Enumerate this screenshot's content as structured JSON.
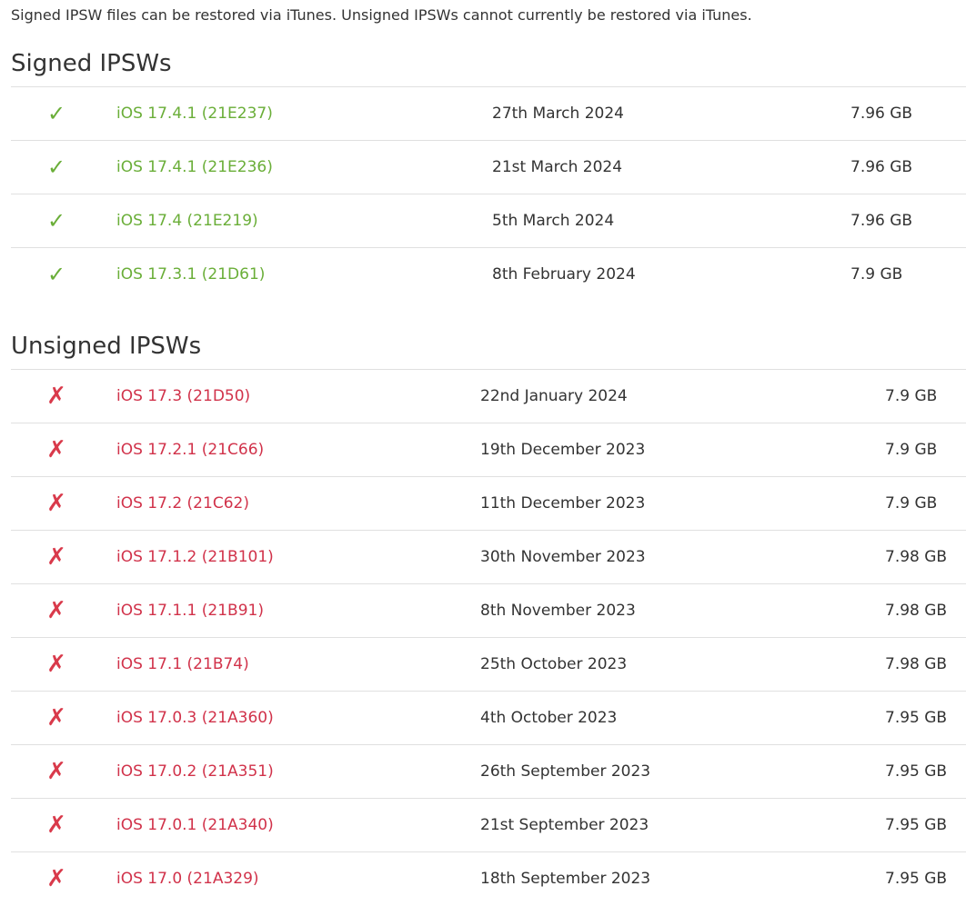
{
  "intro": "Signed IPSW files can be restored via iTunes. Unsigned IPSWs cannot currently be restored via iTunes.",
  "signed": {
    "heading": "Signed IPSWs",
    "icon": "✓",
    "rows": [
      {
        "version": "iOS 17.4.1 (21E237)",
        "date": "27th March 2024",
        "size": "7.96 GB"
      },
      {
        "version": "iOS 17.4.1 (21E236)",
        "date": "21st March 2024",
        "size": "7.96 GB"
      },
      {
        "version": "iOS 17.4 (21E219)",
        "date": "5th March 2024",
        "size": "7.96 GB"
      },
      {
        "version": "iOS 17.3.1 (21D61)",
        "date": "8th February 2024",
        "size": "7.9 GB"
      }
    ]
  },
  "unsigned": {
    "heading": "Unsigned IPSWs",
    "icon": "✗",
    "rows": [
      {
        "version": "iOS 17.3 (21D50)",
        "date": "22nd January 2024",
        "size": "7.9 GB"
      },
      {
        "version": "iOS 17.2.1 (21C66)",
        "date": "19th December 2023",
        "size": "7.9 GB"
      },
      {
        "version": "iOS 17.2 (21C62)",
        "date": "11th December 2023",
        "size": "7.9 GB"
      },
      {
        "version": "iOS 17.1.2 (21B101)",
        "date": "30th November 2023",
        "size": "7.98 GB"
      },
      {
        "version": "iOS 17.1.1 (21B91)",
        "date": "8th November 2023",
        "size": "7.98 GB"
      },
      {
        "version": "iOS 17.1 (21B74)",
        "date": "25th October 2023",
        "size": "7.98 GB"
      },
      {
        "version": "iOS 17.0.3 (21A360)",
        "date": "4th October 2023",
        "size": "7.95 GB"
      },
      {
        "version": "iOS 17.0.2 (21A351)",
        "date": "26th September 2023",
        "size": "7.95 GB"
      },
      {
        "version": "iOS 17.0.1 (21A340)",
        "date": "21st September 2023",
        "size": "7.95 GB"
      },
      {
        "version": "iOS 17.0 (21A329)",
        "date": "18th September 2023",
        "size": "7.95 GB"
      }
    ]
  },
  "colors": {
    "signed_accent": "#6aae38",
    "unsigned_accent": "#d1324a",
    "divider": "#e0e0e0",
    "text": "#333333"
  }
}
